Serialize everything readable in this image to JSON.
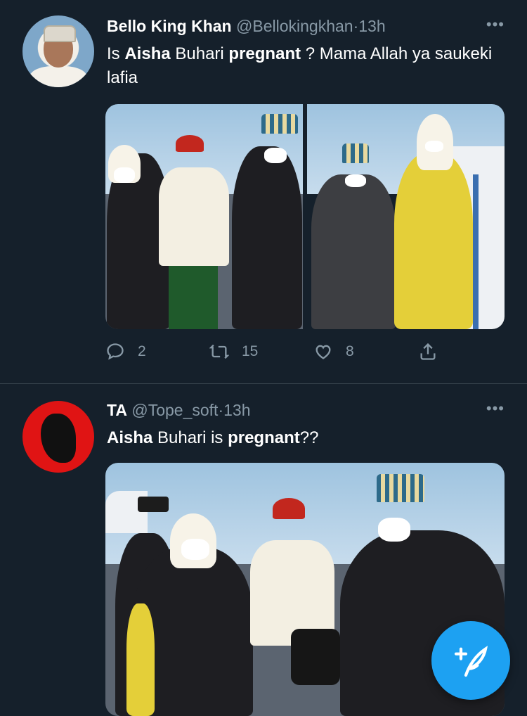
{
  "tweets": [
    {
      "author_name": "Bello King Khan",
      "handle": "@Bellokingkhan",
      "separator": "·",
      "time": "13h",
      "text_parts": [
        "Is ",
        "Aisha",
        " Buhari ",
        "pregnant",
        " ? Mama Allah ya saukeki lafia"
      ],
      "replies": "2",
      "retweets": "15",
      "likes": "8"
    },
    {
      "author_name": "TA",
      "handle": "@Tope_soft",
      "separator": "·",
      "time": "13h",
      "text_parts": [
        "Aisha",
        " Buhari is ",
        "pregnant",
        "??"
      ]
    }
  ],
  "icons": {
    "more": "more-horizontal-icon",
    "reply": "reply-icon",
    "retweet": "retweet-icon",
    "like": "heart-icon",
    "share": "share-icon",
    "compose": "compose-tweet-icon"
  },
  "colors": {
    "background": "#15202b",
    "secondary_text": "#8899a6",
    "accent": "#1da1f2",
    "divider": "#38444d"
  }
}
